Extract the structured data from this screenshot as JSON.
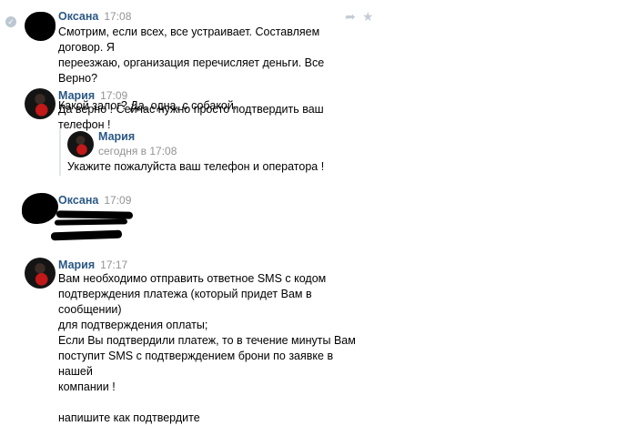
{
  "messages": [
    {
      "author": "Оксана",
      "time": "17:08",
      "lines": [
        "Смотрим, если всех, все устраивает. Составляем договор. Я",
        "переезжаю, организация перечисляет деньги. Все Верно?",
        "",
        "Какой залог? Да, одна, с собакой."
      ]
    },
    {
      "author": "Мария",
      "time": "17:09",
      "lines": [
        "Да верно ! Сейчас нужно просто подтвердить ваш телефон !"
      ],
      "forwarded": {
        "author": "Мария",
        "time": "сегодня в 17:08",
        "text": "Укажите пожалуйста ваш телефон и оператора !"
      }
    },
    {
      "author": "Оксана",
      "time": "17:09"
    },
    {
      "author": "Мария",
      "time": "17:17",
      "lines": [
        "Вам необходимо отправить ответное SMS с кодом",
        "подтверждения платежа (который придет Вам в сообщении)",
        "для подтверждения оплаты;",
        "Если Вы подтвердили платеж, то в течение минуты Вам",
        "поступит SMS с подтверждением брони по заявке в нашей",
        "компании !",
        "",
        "напишите как подтвердите"
      ]
    }
  ],
  "icons": {
    "reply": "reply-icon",
    "star": "star-icon",
    "read": "check-icon"
  }
}
